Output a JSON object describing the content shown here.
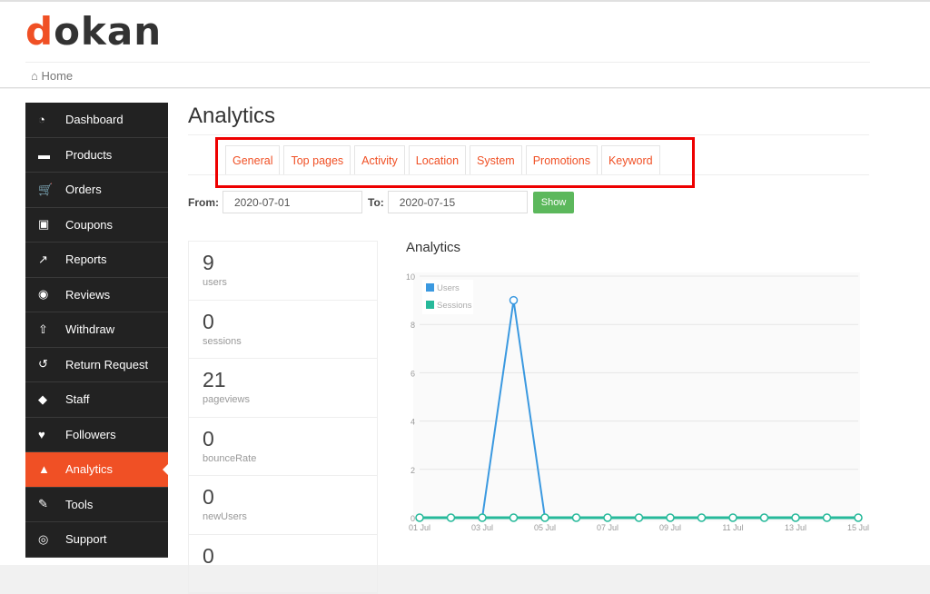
{
  "logo": {
    "first": "d",
    "rest": "okan"
  },
  "breadcrumb": {
    "icon": "home-icon",
    "label": "Home"
  },
  "sidebar": {
    "items": [
      {
        "label": "Dashboard",
        "icon": "dashboard-icon",
        "glyph": "◔"
      },
      {
        "label": "Products",
        "icon": "briefcase-icon",
        "glyph": "▬"
      },
      {
        "label": "Orders",
        "icon": "cart-icon",
        "glyph": "🛒"
      },
      {
        "label": "Coupons",
        "icon": "gift-icon",
        "glyph": "▣"
      },
      {
        "label": "Reports",
        "icon": "line-chart-icon",
        "glyph": "↗"
      },
      {
        "label": "Reviews",
        "icon": "comments-icon",
        "glyph": "◉"
      },
      {
        "label": "Withdraw",
        "icon": "upload-icon",
        "glyph": "⇧"
      },
      {
        "label": "Return Request",
        "icon": "undo-icon",
        "glyph": "↺"
      },
      {
        "label": "Staff",
        "icon": "users-icon",
        "glyph": "◆"
      },
      {
        "label": "Followers",
        "icon": "heart-icon",
        "glyph": "♥"
      },
      {
        "label": "Analytics",
        "icon": "area-chart-icon",
        "glyph": "▲",
        "active": true
      },
      {
        "label": "Tools",
        "icon": "wrench-icon",
        "glyph": "✎"
      },
      {
        "label": "Support",
        "icon": "life-ring-icon",
        "glyph": "◎"
      }
    ]
  },
  "page": {
    "title": "Analytics"
  },
  "tabs": [
    "General",
    "Top pages",
    "Activity",
    "Location",
    "System",
    "Promotions",
    "Keyword"
  ],
  "filter": {
    "from_label": "From:",
    "from_value": "2020-07-01",
    "to_label": "To:",
    "to_value": "2020-07-15",
    "show_label": "Show"
  },
  "stats": [
    {
      "value": "9",
      "label": "users"
    },
    {
      "value": "0",
      "label": "sessions"
    },
    {
      "value": "21",
      "label": "pageviews"
    },
    {
      "value": "0",
      "label": "bounceRate"
    },
    {
      "value": "0",
      "label": "newUsers"
    },
    {
      "value": "0",
      "label": ""
    }
  ],
  "chart_data": {
    "type": "line",
    "title": "Analytics",
    "x": [
      "01 Jul",
      "02 Jul",
      "03 Jul",
      "04 Jul",
      "05 Jul",
      "06 Jul",
      "07 Jul",
      "08 Jul",
      "09 Jul",
      "10 Jul",
      "11 Jul",
      "12 Jul",
      "13 Jul",
      "14 Jul",
      "15 Jul"
    ],
    "xticks": [
      "01 Jul",
      "03 Jul",
      "05 Jul",
      "07 Jul",
      "09 Jul",
      "11 Jul",
      "13 Jul",
      "15 Jul"
    ],
    "yticks": [
      0,
      2,
      4,
      6,
      8,
      10
    ],
    "ylim": [
      0,
      10
    ],
    "series": [
      {
        "name": "Users",
        "color": "#3b99e0",
        "values": [
          0,
          0,
          0,
          9,
          0,
          0,
          0,
          0,
          0,
          0,
          0,
          0,
          0,
          0,
          0
        ]
      },
      {
        "name": "Sessions",
        "color": "#26b99a",
        "values": [
          0,
          0,
          0,
          0,
          0,
          0,
          0,
          0,
          0,
          0,
          0,
          0,
          0,
          0,
          0
        ]
      }
    ],
    "legend": "top-left",
    "grid": true
  }
}
